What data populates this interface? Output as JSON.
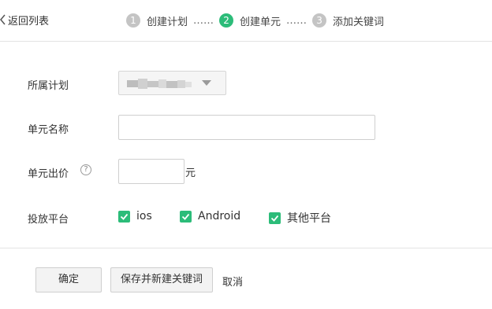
{
  "header": {
    "back_label": "返回列表",
    "steps": [
      {
        "num": "1",
        "label": "创建计划"
      },
      {
        "num": "2",
        "label": "创建单元"
      },
      {
        "num": "3",
        "label": "添加关键词"
      }
    ],
    "separator": "……",
    "active_step": 2,
    "accent_color": "#2cbc79",
    "inactive_color": "#c4c4c4"
  },
  "form": {
    "plan_label": "所属计划",
    "plan_value": "",
    "unit_name_label": "单元名称",
    "unit_name_value": "",
    "bid_label": "单元出价",
    "bid_help_icon": "question-circle-icon",
    "bid_help_glyph": "?",
    "bid_value": "",
    "bid_unit": "元",
    "platform_label": "投放平台",
    "platforms": [
      {
        "label": "ios",
        "checked": true
      },
      {
        "label": "Android",
        "checked": true
      },
      {
        "label": "其他平台",
        "checked": true
      }
    ]
  },
  "actions": {
    "confirm_label": "确定",
    "save_new_label": "保存并新建关键词",
    "cancel_label": "取消"
  }
}
